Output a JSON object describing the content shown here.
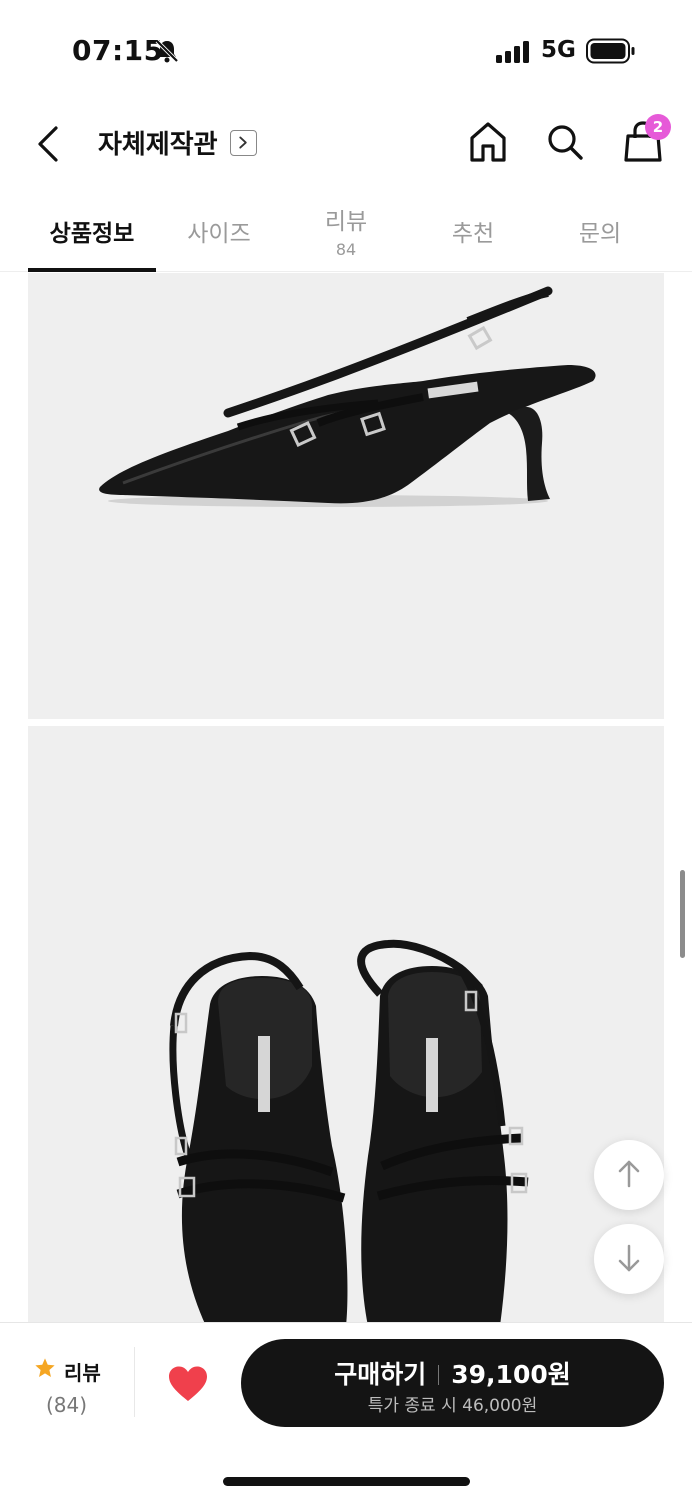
{
  "status_bar": {
    "time": "07:15",
    "network": "5G",
    "icons": [
      "bell-muted-icon",
      "signal-icon",
      "battery-icon"
    ]
  },
  "header": {
    "title": "자체제작관",
    "cart_count": "2",
    "icons": [
      "back-icon",
      "chevron-right-icon",
      "home-icon",
      "search-icon",
      "cart-icon"
    ],
    "badge_color": "#e65ad8"
  },
  "tabs": [
    {
      "label": "상품정보",
      "active": true
    },
    {
      "label": "사이즈"
    },
    {
      "label": "리뷰",
      "count": "84"
    },
    {
      "label": "추천"
    },
    {
      "label": "문의"
    }
  ],
  "product_images": [
    {
      "icon": "slingback-heel-side-view-image"
    },
    {
      "icon": "slingback-heel-top-view-image"
    }
  ],
  "float_buttons": [
    "arrow-up-icon",
    "arrow-down-icon"
  ],
  "bottom_bar": {
    "review_label": "리뷰",
    "review_count": "(84)",
    "buy_label": "구매하기",
    "price": "39,100원",
    "sale_note": "특가 종료 시 46,000원",
    "star_color": "#f5a623",
    "heart_color": "#f0404c",
    "buy_button_color": "#141414"
  }
}
